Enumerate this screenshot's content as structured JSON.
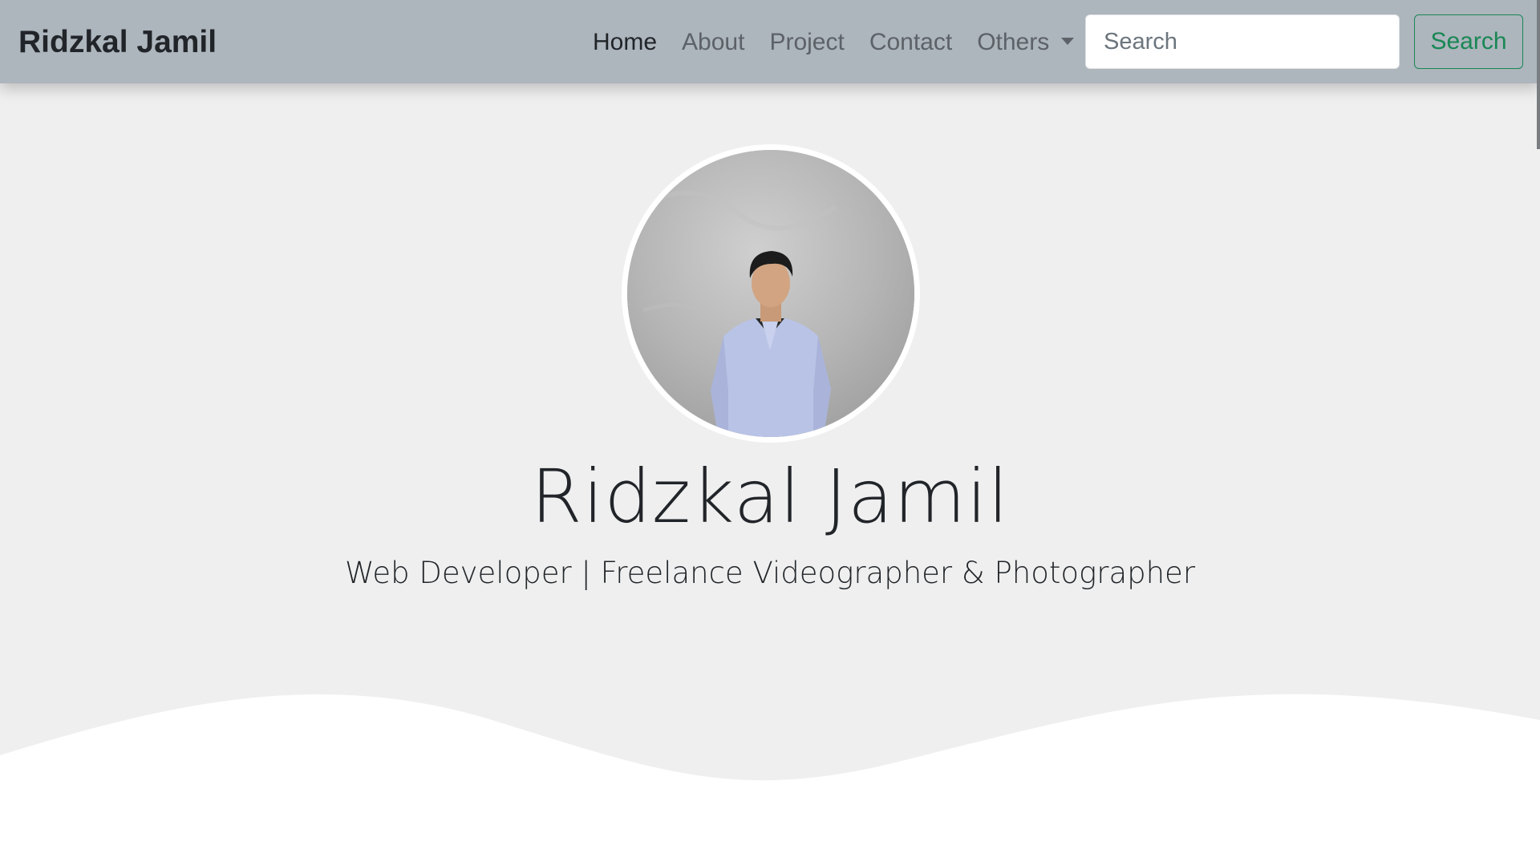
{
  "navbar": {
    "brand": "Ridzkal Jamil",
    "links": [
      {
        "label": "Home",
        "active": true
      },
      {
        "label": "About",
        "active": false
      },
      {
        "label": "Project",
        "active": false
      },
      {
        "label": "Contact",
        "active": false
      },
      {
        "label": "Others",
        "active": false,
        "dropdown": true
      }
    ],
    "search_placeholder": "Search",
    "search_button": "Search",
    "bg_color": "#adb5bd"
  },
  "hero": {
    "name": "Ridzkal Jamil",
    "subtitle": "Web Developer | Freelance Videographer & Photographer",
    "avatar_icon": "profile-photo",
    "bg_color": "#efefef"
  },
  "colors": {
    "accent": "#198754",
    "text": "#212529",
    "muted": "#5c6268"
  }
}
